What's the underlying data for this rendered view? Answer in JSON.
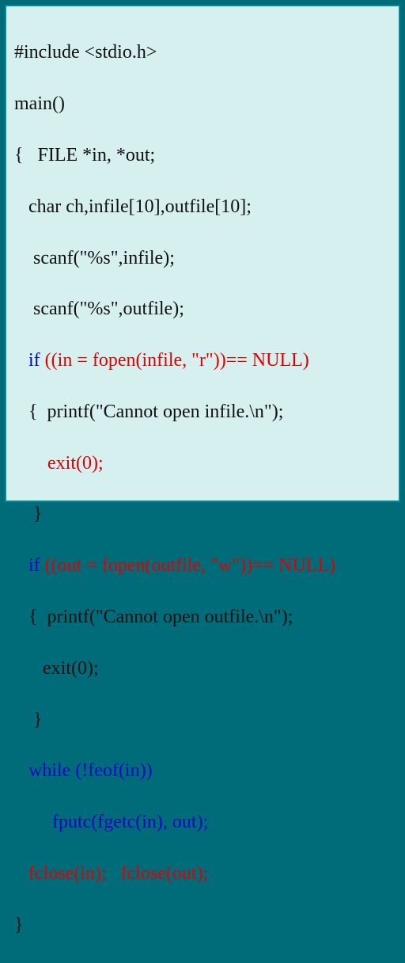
{
  "colors": {
    "background": "#d6efef",
    "border": "#008b9a",
    "normal": "#111111",
    "red": "#e10000",
    "blue": "#0008c7"
  },
  "code": {
    "l01": "#include <stdio.h>",
    "l02": "main()",
    "l03": "{   FILE *in, *out;",
    "l04": "   char ch,infile[10],outfile[10];",
    "l05": "    scanf(\"%s\",infile);",
    "l06": "    scanf(\"%s\",outfile);",
    "l07a": "   if ",
    "l07b": "((in = fopen(infile, \"r\"))== NULL)",
    "l08": "   {  printf(\"Cannot open infile.\\n\");",
    "l09": "       exit(0);",
    "l10": "    }",
    "l11a": "   if ",
    "l11b": "((out = fopen(outfile, \"w\"))== NULL)",
    "l12": "   {  printf(\"Cannot open outfile.\\n\");",
    "l13": "      exit(0);",
    "l14": "    }",
    "l15": "   while (!feof(in))",
    "l16": "        fputc(fgetc(in), out);",
    "l17": "   fclose(in);   fclose(out);",
    "l18": "}"
  }
}
